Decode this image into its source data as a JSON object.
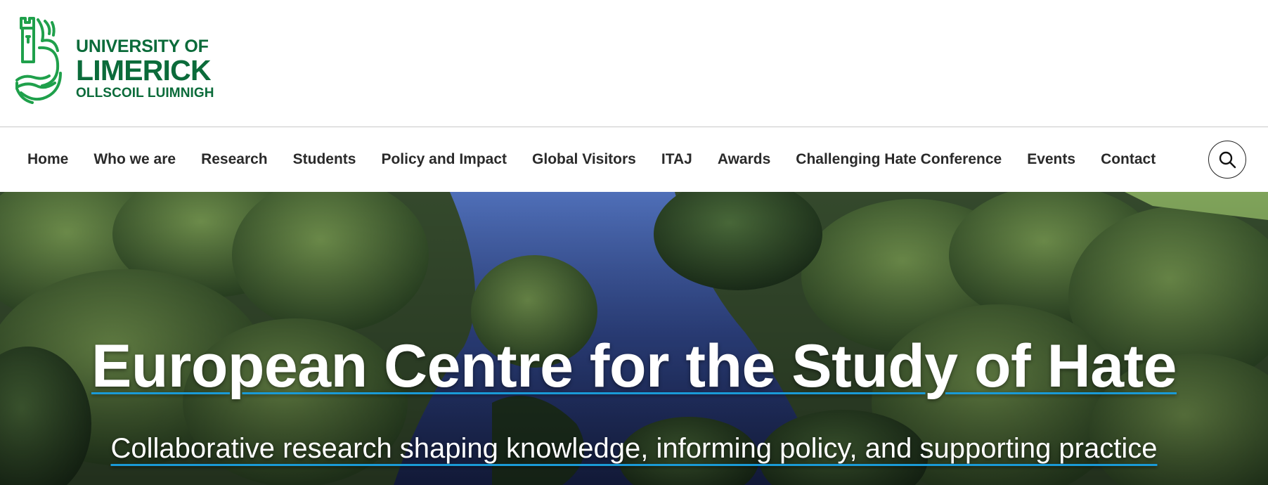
{
  "logo": {
    "line1": "UNIVERSITY OF",
    "line2": "LIMERICK",
    "line3": "OLLSCOIL LUIMNIGH",
    "icon": "university-crest-icon",
    "color": "#0b6b3a",
    "crest_color": "#1fa04b"
  },
  "nav": {
    "items": [
      {
        "label": "Home"
      },
      {
        "label": "Who we are"
      },
      {
        "label": "Research"
      },
      {
        "label": "Students"
      },
      {
        "label": "Policy and Impact"
      },
      {
        "label": "Global Visitors"
      },
      {
        "label": "ITAJ"
      },
      {
        "label": "Awards"
      },
      {
        "label": "Challenging Hate Conference"
      },
      {
        "label": "Events"
      },
      {
        "label": "Contact"
      }
    ],
    "search_icon": "search-icon"
  },
  "hero": {
    "title": "European Centre for the Study of Hate",
    "subtitle": "Collaborative research shaping knowledge, informing policy, and supporting practice",
    "underline_color": "#1a9ad6",
    "background": "aerial-river-trees-photo"
  }
}
